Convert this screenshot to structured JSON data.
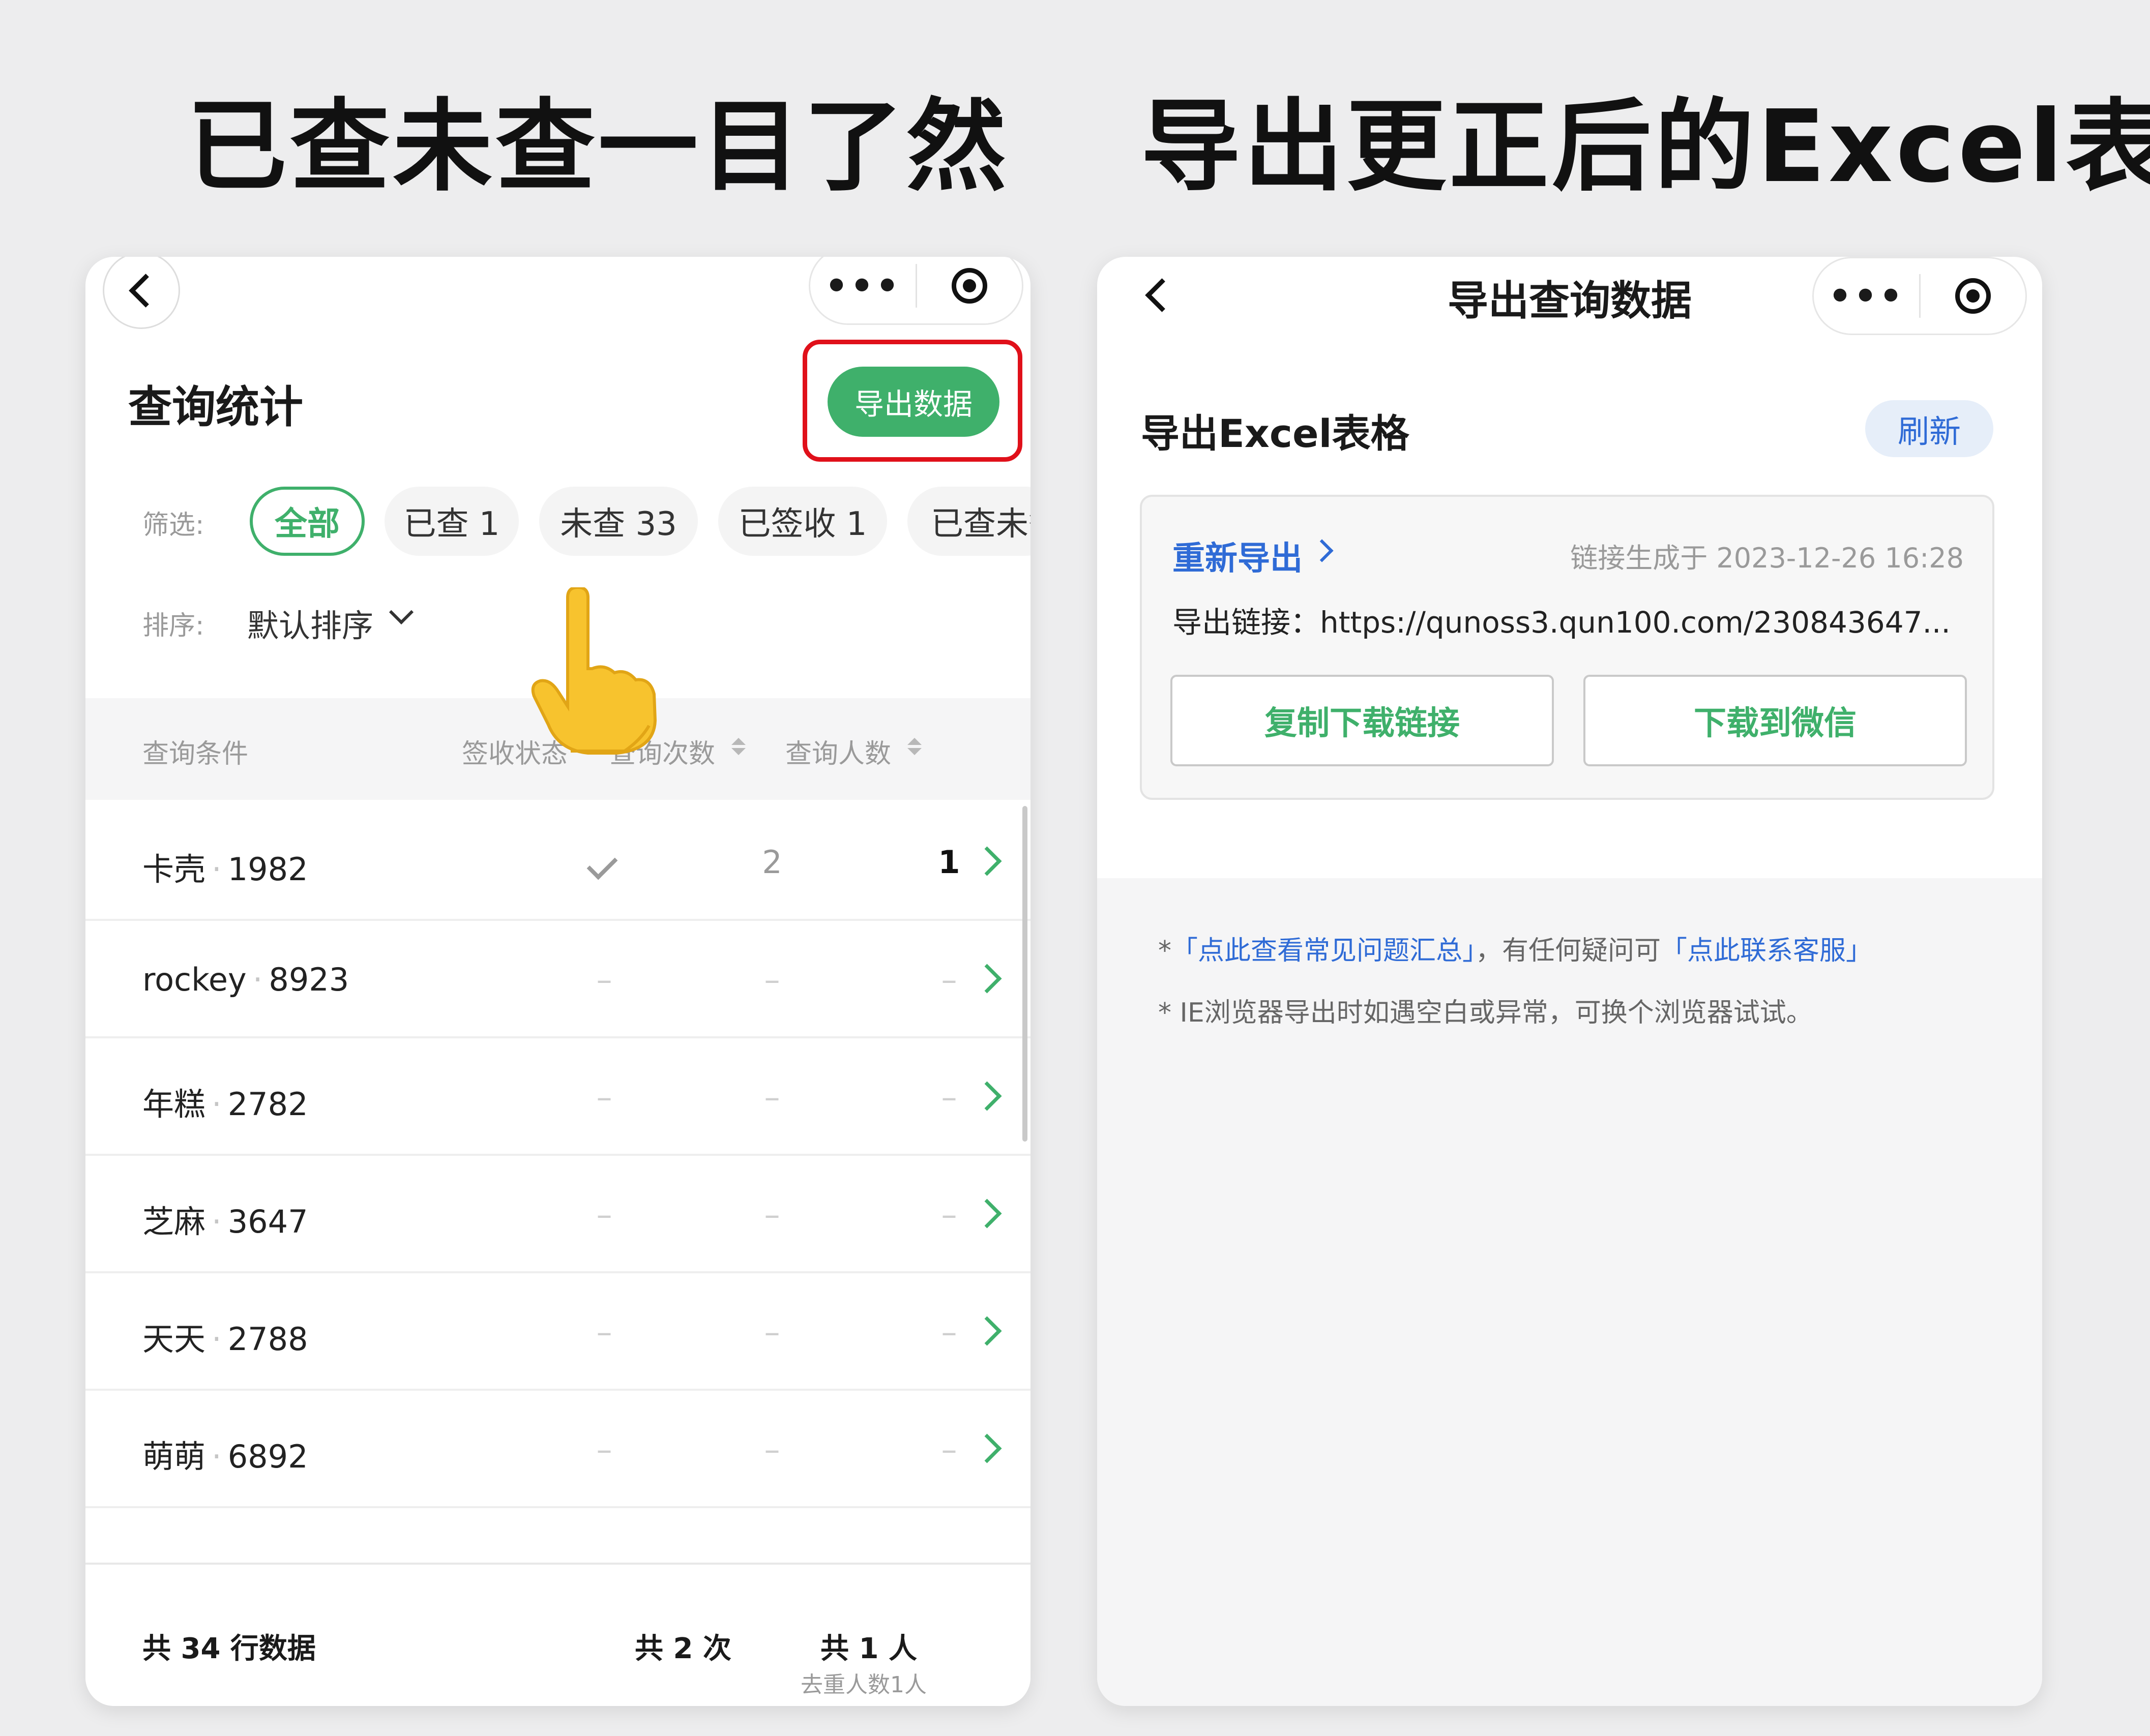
{
  "headlines": {
    "left": "已查未查一目了然",
    "right": "导出更正后的Excel表"
  },
  "left_panel": {
    "capsule": {
      "more": "•••"
    },
    "title": "查询统计",
    "export_button": "导出数据",
    "filter": {
      "label": "筛选:",
      "chips": [
        "全部",
        "已查 1",
        "未查 33",
        "已签收 1",
        "已查未签"
      ]
    },
    "sort": {
      "label": "排序:",
      "value": "默认排序"
    },
    "columns": [
      "查询条件",
      "签收状态",
      "查询次数",
      "查询人数"
    ],
    "rows": [
      {
        "name": "卡壳",
        "id": "1982",
        "count": "2",
        "people": "1"
      },
      {
        "name": "rockey",
        "id": "8923",
        "count": "–",
        "people": "–",
        "sign": "–"
      },
      {
        "name": "年糕",
        "id": "2782",
        "count": "–",
        "people": "–",
        "sign": "–"
      },
      {
        "name": "芝麻",
        "id": "3647",
        "count": "–",
        "people": "–",
        "sign": "–"
      },
      {
        "name": "天天",
        "id": "2788",
        "count": "–",
        "people": "–",
        "sign": "–"
      },
      {
        "name": "萌萌",
        "id": "6892",
        "count": "–",
        "people": "–",
        "sign": "–"
      }
    ],
    "footer": {
      "total_rows": "共 34 行数据",
      "total_times": "共 2 次",
      "total_people": "共 1 人",
      "dedup": "去重人数1人"
    }
  },
  "right_panel": {
    "capsule": {
      "more": "•••"
    },
    "nav_title": "导出查询数据",
    "section_title": "导出Excel表格",
    "refresh_button": "刷新",
    "reexport": "重新导出",
    "generated": "链接生成于 2023-12-26 16:28",
    "export_link": "导出链接：https://qunoss3.qun100.com/230843647...",
    "copy_button": "复制下载链接",
    "wechat_button": "下载到微信",
    "notes": {
      "star": "*",
      "faq_link": "「点此查看常见问题汇总」",
      "middle": "，有任何疑问可",
      "contact_link": "「点此联系客服」",
      "ie_note": "* IE浏览器导出时如遇空白或异常，可换个浏览器试试。"
    }
  },
  "colors": {
    "brand_green": "#3fb06b",
    "highlight_red": "#e0101a",
    "link_blue": "#2f6bd6"
  }
}
